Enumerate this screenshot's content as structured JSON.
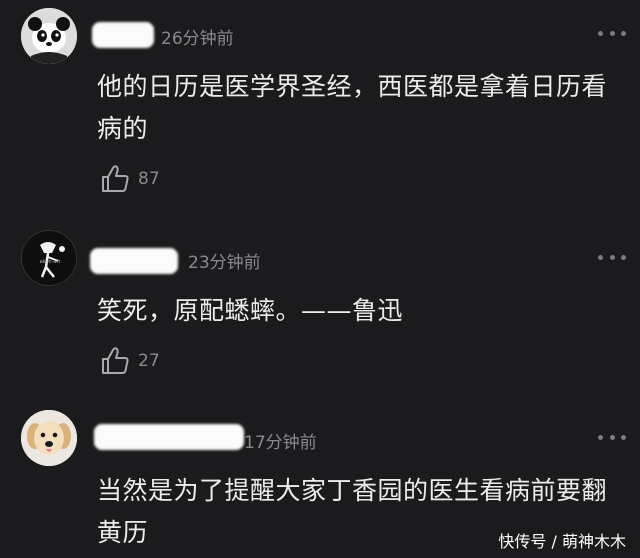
{
  "comments": [
    {
      "time": "26分钟前",
      "text": "他的日历是医学界圣经，西医都是拿着日历看病的",
      "likes": "87",
      "avatar_icon": "cartoon-panda-avatar"
    },
    {
      "time": "23分钟前",
      "text": "笑死，原配蟋蟀。——鲁迅",
      "likes": "27",
      "avatar_icon": "sketch-figure-avatar"
    },
    {
      "time": "17分钟前",
      "text": "当然是为了提醒大家丁香园的医生看病前要翻黄历",
      "likes": "",
      "avatar_icon": "golden-retriever-puppy-avatar"
    }
  ],
  "watermark": "快传号 / 萌神木木",
  "colors": {
    "background": "#1b1b1d",
    "text": "#ececec",
    "meta": "#8a8a8d"
  }
}
